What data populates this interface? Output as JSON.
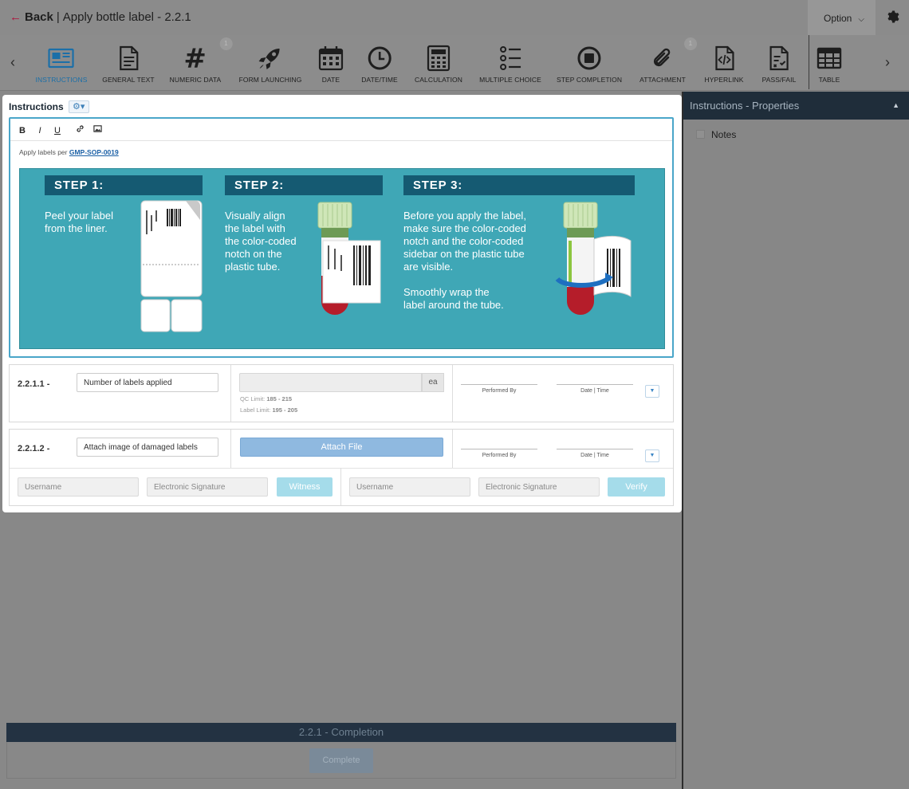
{
  "header": {
    "back_arrow": "←",
    "back_label": "Back",
    "separator": "|",
    "title": "Apply bottle label - 2.2.1",
    "option_label": "Option",
    "option_chevron": "⌵",
    "settings_icon": "gear-icon"
  },
  "toolbar": {
    "prev_arrow": "‹",
    "next_arrow": "›",
    "items": [
      {
        "label": "INSTRUCTIONS",
        "icon": "newspaper-icon"
      },
      {
        "label": "GENERAL TEXT",
        "icon": "document-text-icon"
      },
      {
        "label": "NUMERIC DATA",
        "icon": "hash-icon",
        "badge": "1"
      },
      {
        "label": "FORM LAUNCHING",
        "icon": "rocket-icon"
      },
      {
        "label": "DATE",
        "icon": "calendar-icon"
      },
      {
        "label": "DATE/TIME",
        "icon": "clock-icon"
      },
      {
        "label": "CALCULATION",
        "icon": "calculator-icon"
      },
      {
        "label": "MULTIPLE CHOICE",
        "icon": "list-options-icon"
      },
      {
        "label": "STEP COMPLETION",
        "icon": "stop-circle-icon"
      },
      {
        "label": "ATTACHMENT",
        "icon": "paperclip-icon",
        "badge": "1"
      },
      {
        "label": "HYPERLINK",
        "icon": "code-file-icon"
      },
      {
        "label": "PASS/FAIL",
        "icon": "checklist-file-icon"
      },
      {
        "label": "TABLE",
        "icon": "table-icon"
      }
    ]
  },
  "instructions": {
    "title": "Instructions",
    "gear_glyph": "⚙▾",
    "editor_tools": [
      "B",
      "I",
      "U",
      "🔗",
      "▣"
    ],
    "text_prefix": "Apply labels per ",
    "link_text": "GMP-SOP-0019",
    "steps": [
      {
        "banner": "STEP 1:",
        "text": "Peel your label\nfrom the liner."
      },
      {
        "banner": "STEP 2:",
        "text": "Visually align\nthe label with\nthe color-coded\nnotch on the\nplastic tube."
      },
      {
        "banner": "STEP 3:",
        "text": "Before you apply the label,\nmake sure the color-coded\nnotch and the color-coded\nsidebar on the plastic tube\nare visible.\n\nSmoothly wrap the\nlabel around the tube."
      }
    ]
  },
  "rows": [
    {
      "id": "2.2.1.1",
      "dash": "-",
      "label": "Number of labels applied",
      "unit": "ea",
      "qc_limit_label": "QC Limit: ",
      "qc_limit": "185 - 215",
      "label_limit_label": "Label Limit: ",
      "label_limit": "195 - 205",
      "performed_by": "Performed By",
      "date_time": "Date | Time"
    },
    {
      "id": "2.2.1.2",
      "dash": "-",
      "label": "Attach image of damaged labels",
      "attach_label": "Attach File",
      "performed_by": "Performed By",
      "date_time": "Date | Time",
      "witness": {
        "username_ph": "Username",
        "signature_ph": "Electronic Signature",
        "button": "Witness"
      },
      "verify": {
        "username_ph": "Username",
        "signature_ph": "Electronic Signature",
        "button": "Verify"
      }
    }
  ],
  "properties": {
    "title": "Instructions - Properties",
    "caret": "▲",
    "notes_label": "Notes"
  },
  "completion": {
    "bar_title": "2.2.1 - Completion",
    "button": "Complete"
  },
  "colors": {
    "accent": "#1b6fa8",
    "infographic_bg": "#3fa7b6",
    "banner": "#155a72",
    "props_header": "#1f2d3a"
  }
}
